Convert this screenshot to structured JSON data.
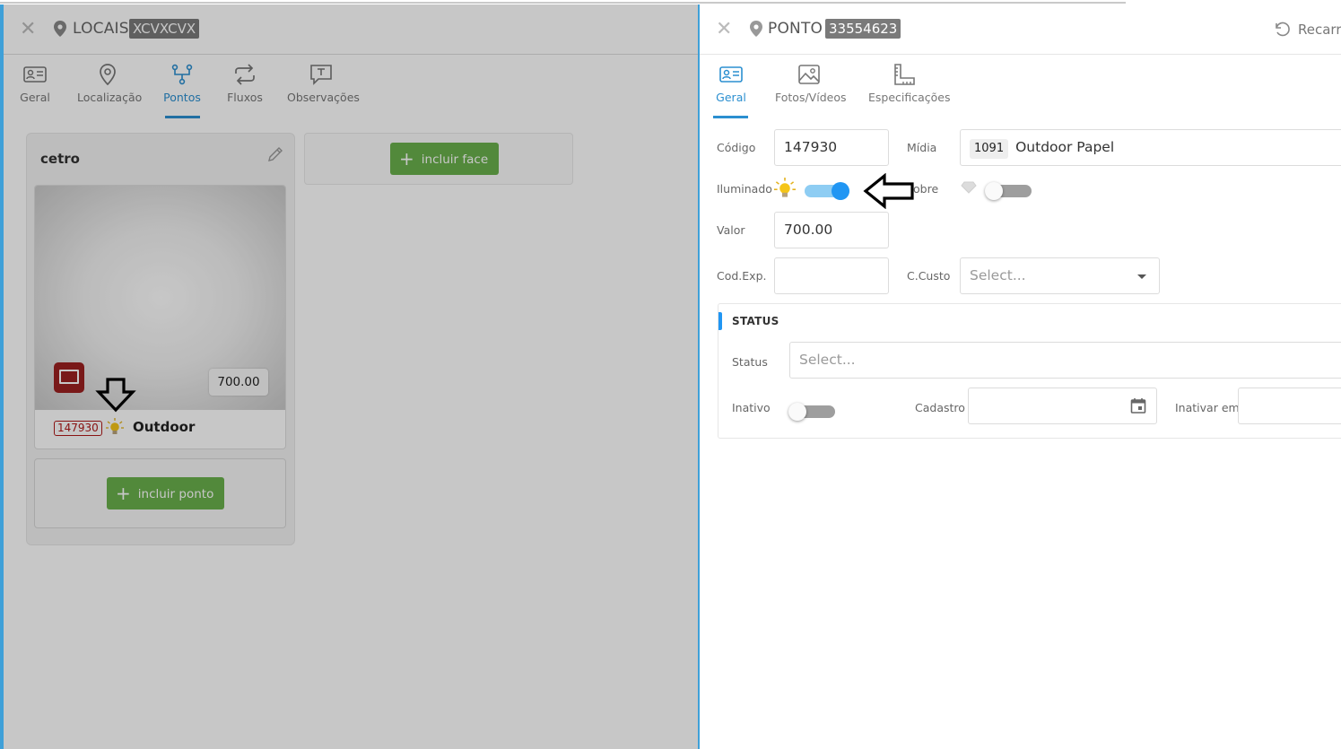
{
  "left_panel": {
    "title": "LOCAIS",
    "badge": "XCVXCVX",
    "tabs": [
      {
        "label": "Geral",
        "icon": "id-card-icon"
      },
      {
        "label": "Localização",
        "icon": "map-pin-icon"
      },
      {
        "label": "Pontos",
        "icon": "nodes-icon"
      },
      {
        "label": "Fluxos",
        "icon": "repeat-arrows-icon"
      },
      {
        "label": "Observações",
        "icon": "comment-icon"
      }
    ],
    "active_tab": "Pontos",
    "face": {
      "title": "cetro",
      "point": {
        "price": "700.00",
        "code": "147930",
        "name": "Outdoor"
      },
      "add_point_label": "incluir ponto"
    },
    "add_face_label": "incluir face"
  },
  "right_panel": {
    "title": "PONTO",
    "badge": "33554623",
    "reload_label": "Recarre",
    "tabs": [
      {
        "label": "Geral",
        "icon": "id-card-icon"
      },
      {
        "label": "Fotos/Vídeos",
        "icon": "image-icon"
      },
      {
        "label": "Especificações",
        "icon": "ruler-icon"
      }
    ],
    "active_tab": "Geral",
    "form": {
      "codigo_label": "Código",
      "codigo_value": "147930",
      "midia_label": "Mídia",
      "midia_code": "1091",
      "midia_value": "Outdoor Papel",
      "iluminado_label": "Iluminado",
      "iluminado_on": true,
      "nobre_label": "obre",
      "nobre_on": false,
      "valor_label": "Valor",
      "valor_value": "700.00",
      "codexp_label": "Cod.Exp.",
      "codexp_value": "",
      "ccusto_label": "C.Custo",
      "ccusto_placeholder": "Select..."
    },
    "status_section": {
      "title": "STATUS",
      "status_label": "Status",
      "status_placeholder": "Select...",
      "inativo_label": "Inativo",
      "inativo_on": false,
      "cadastro_label": "Cadastro",
      "cadastro_value": "",
      "inativar_label": "Inativar em",
      "inativar_value": ""
    }
  },
  "colors": {
    "accent": "#2196f3",
    "green_button": "#6ab04c",
    "code_red": "#b01818",
    "billboard_red": "#9b2020",
    "bulb_yellow": "#f5c518"
  }
}
